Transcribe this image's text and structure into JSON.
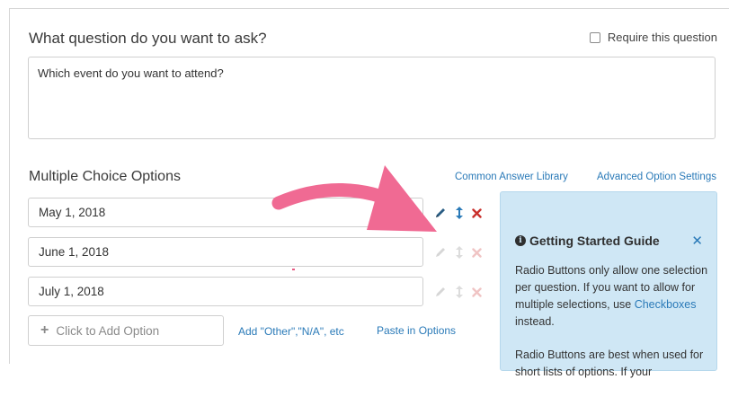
{
  "question": {
    "label": "What question do you want to ask?",
    "require_label": "Require this question",
    "text": "Which event do you want to attend?"
  },
  "options": {
    "heading": "Multiple Choice Options",
    "common_library_link": "Common Answer Library",
    "advanced_settings_link": "Advanced Option Settings",
    "items": [
      "May 1, 2018",
      "June 1, 2018",
      "July 1, 2018"
    ],
    "add_option_label": "Click to Add Option",
    "add_other_link": "Add \"Other\",\"N/A\", etc",
    "paste_link": "Paste in Options"
  },
  "guide": {
    "title": "Getting Started Guide",
    "para1_before": "Radio Buttons only allow one selection per question. If you want to allow for multiple selections, use ",
    "para1_link": "Checkboxes",
    "para1_after": " instead.",
    "para2": "Radio Buttons are best when used for short lists of options. If your"
  },
  "colors": {
    "link": "#2a7ab8",
    "guide_bg": "#cfe7f5",
    "arrow": "#f06a93",
    "delete_active": "#c9302c"
  },
  "icons": [
    "pencil-icon",
    "reorder-icon",
    "delete-icon",
    "info-icon",
    "close-icon",
    "plus-icon"
  ]
}
